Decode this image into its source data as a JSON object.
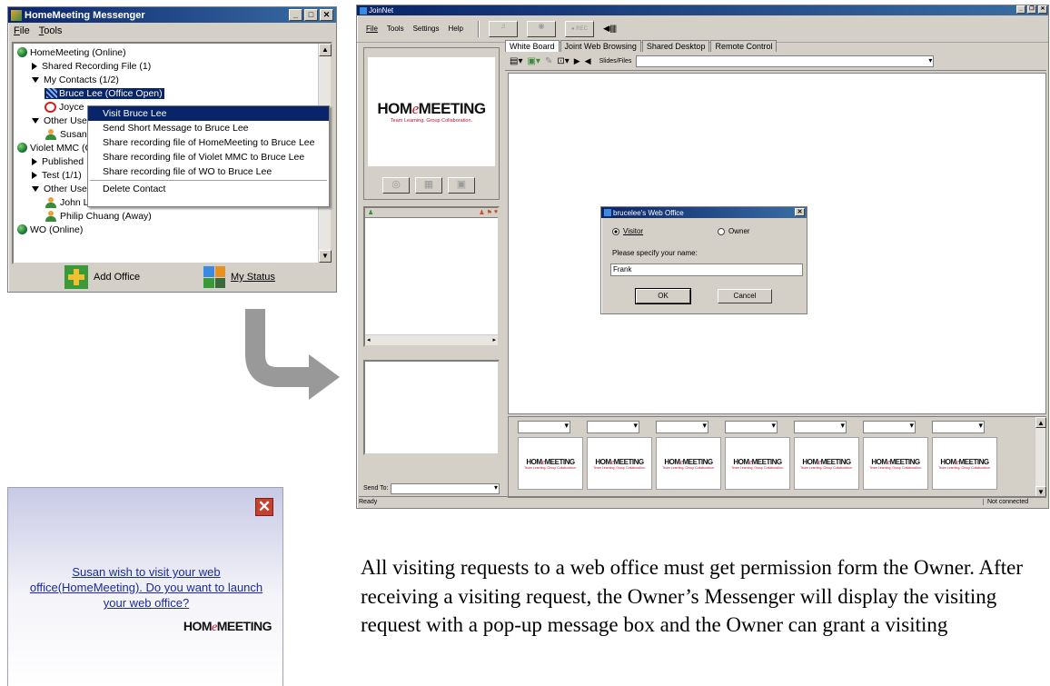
{
  "messenger": {
    "title": "HomeMeeting Messenger",
    "menu": [
      "File",
      "Tools"
    ],
    "tree": {
      "office1": "HomeMeeting (Online)",
      "shared_rec": "Shared Recording File (1)",
      "my_contacts": "My Contacts (1/2)",
      "bruce": "Bruce Lee (Office Open)",
      "joyce": "Joyce",
      "other_users": "Other Use",
      "susan": "Susan",
      "violet": "Violet MMC (C",
      "published": "Published",
      "test": "Test (1/1)",
      "other_users2": "Other Use",
      "john": "John Liu (Online)",
      "philip": "Philip Chuang (Away)",
      "wo": "WO (Online)"
    },
    "context_menu": [
      "Visit Bruce Lee",
      "Send Short Message to Bruce Lee",
      "Share recording file of HomeMeeting to Bruce Lee",
      "Share recording file of Violet MMC to Bruce Lee",
      "Share recording file of WO to Bruce Lee",
      "Delete Contact"
    ],
    "add_office": "Add Office",
    "my_status": "My Status"
  },
  "joinnet": {
    "title": "JoinNet",
    "menu": [
      "File",
      "Tools",
      "Settings",
      "Help"
    ],
    "rec_label": "● REC",
    "tabs": [
      "White Board",
      "Joint Web Browsing",
      "Shared Desktop",
      "Remote Control"
    ],
    "slides_label": "Slides/Files",
    "logo_pre": "HOM",
    "logo_e": "e",
    "logo_post": "MEETING",
    "logo_tagline": "Team Learning.  Group Collaboration.",
    "send_to": "Send To:",
    "status_left": "Ready",
    "status_right": "Not connected",
    "thumb_tagline": "Team Learning.  Group Collaboration."
  },
  "dialog": {
    "title": "brucelee's Web Office",
    "visitor": "Visitor",
    "owner": "Owner",
    "prompt": "Please specify your name:",
    "name_value": "Frank",
    "ok": "OK",
    "cancel": "Cancel"
  },
  "popup": {
    "message": "Susan wish to visit your web office(HomeMeeting). Do you want to launch your web office?",
    "logo_pre": "HOM",
    "logo_e": "e",
    "logo_post": "MEETING"
  },
  "caption": "All visiting requests to a web office must get permission form the Owner. After receiving a visiting request, the Owner’s Messenger will display the visiting request with a pop-up message box and the Owner can grant a visiting",
  "colors": {
    "titlebar": "#0a246a",
    "accent_red": "#c0102a",
    "arrow": "#999999"
  }
}
